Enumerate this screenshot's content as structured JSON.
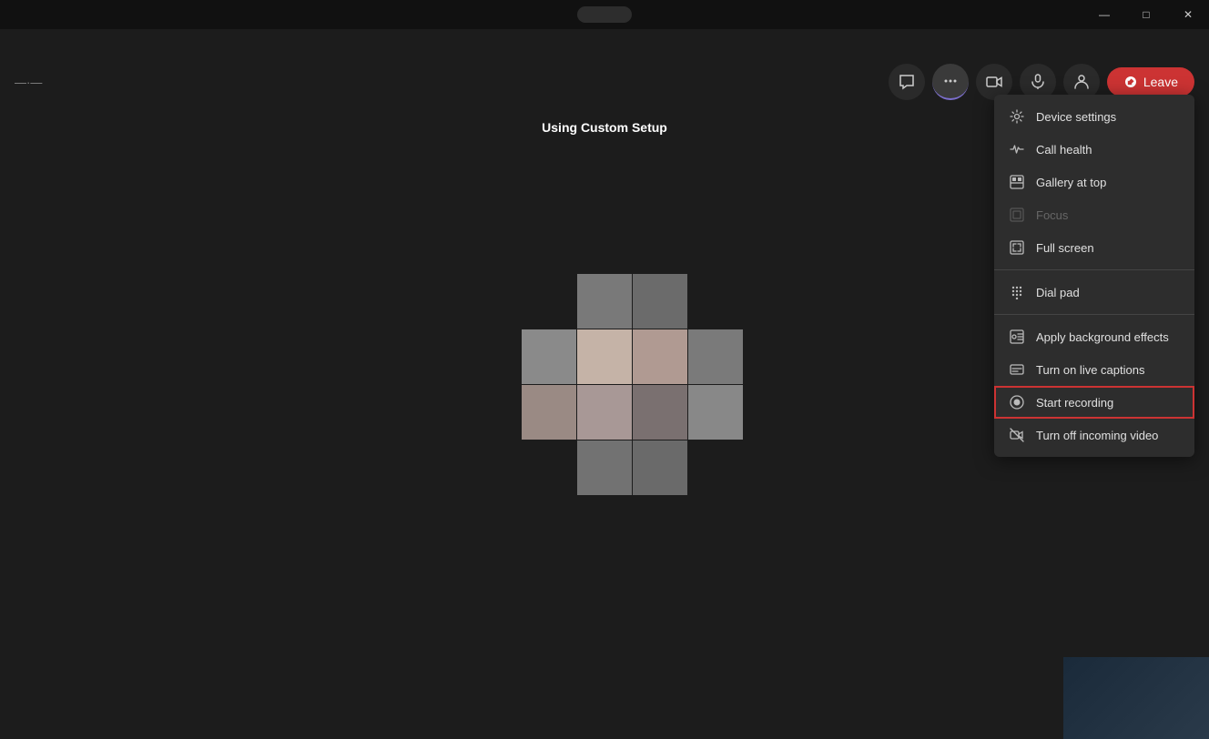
{
  "titlebar": {
    "minimize_label": "—",
    "maximize_label": "□",
    "close_label": "✕"
  },
  "topbar": {
    "left_indicator": "—·—",
    "chat_icon": "💬",
    "more_icon": "•••",
    "video_icon": "📹",
    "mic_icon": "🎤",
    "participants_icon": "👤",
    "leave_label": "Leave",
    "leave_icon": "📞"
  },
  "call": {
    "custom_setup_label": "Using Custom Setup"
  },
  "menu": {
    "items": [
      {
        "id": "device-settings",
        "label": "Device settings",
        "icon": "settings",
        "disabled": false,
        "highlighted": false,
        "separator_after": false
      },
      {
        "id": "call-health",
        "label": "Call health",
        "icon": "pulse",
        "disabled": false,
        "highlighted": false,
        "separator_after": false
      },
      {
        "id": "gallery-top",
        "label": "Gallery at top",
        "icon": "gallery",
        "disabled": false,
        "highlighted": false,
        "separator_after": false
      },
      {
        "id": "focus",
        "label": "Focus",
        "icon": "focus",
        "disabled": true,
        "highlighted": false,
        "separator_after": false
      },
      {
        "id": "full-screen",
        "label": "Full screen",
        "icon": "fullscreen",
        "disabled": false,
        "highlighted": false,
        "separator_after": true
      },
      {
        "id": "dial-pad",
        "label": "Dial pad",
        "icon": "dialpad",
        "disabled": false,
        "highlighted": false,
        "separator_after": true
      },
      {
        "id": "apply-background",
        "label": "Apply background effects",
        "icon": "effects",
        "disabled": false,
        "highlighted": false,
        "separator_after": false
      },
      {
        "id": "live-captions",
        "label": "Turn on live captions",
        "icon": "captions",
        "disabled": false,
        "highlighted": false,
        "separator_after": false
      },
      {
        "id": "start-recording",
        "label": "Start recording",
        "icon": "record",
        "disabled": false,
        "highlighted": true,
        "separator_after": false
      },
      {
        "id": "incoming-video",
        "label": "Turn off incoming video",
        "icon": "video-off",
        "disabled": false,
        "highlighted": false,
        "separator_after": false
      }
    ]
  },
  "colors": {
    "accent": "#7c6fcd",
    "leave": "#cc3333",
    "highlight_border": "#cc3333",
    "bg_dark": "#1c1c1c",
    "menu_bg": "#2d2d2d"
  },
  "pixels": [
    {
      "col": 1,
      "row": 0,
      "color": "#7a7a7a"
    },
    {
      "col": 2,
      "row": 0,
      "color": "#6a6a6a"
    },
    {
      "col": 0,
      "row": 1,
      "color": "#888"
    },
    {
      "col": 1,
      "row": 1,
      "color": "#c8b4a8"
    },
    {
      "col": 2,
      "row": 1,
      "color": "#b0a09a"
    },
    {
      "col": 3,
      "row": 1,
      "color": "#7a7a7a"
    },
    {
      "col": 0,
      "row": 2,
      "color": "#9a8a84"
    },
    {
      "col": 1,
      "row": 2,
      "color": "#a89a94"
    },
    {
      "col": 2,
      "row": 2,
      "color": "#7a7070"
    },
    {
      "col": 1,
      "row": 3,
      "color": "#707070"
    },
    {
      "col": 2,
      "row": 3,
      "color": "#686868"
    }
  ]
}
